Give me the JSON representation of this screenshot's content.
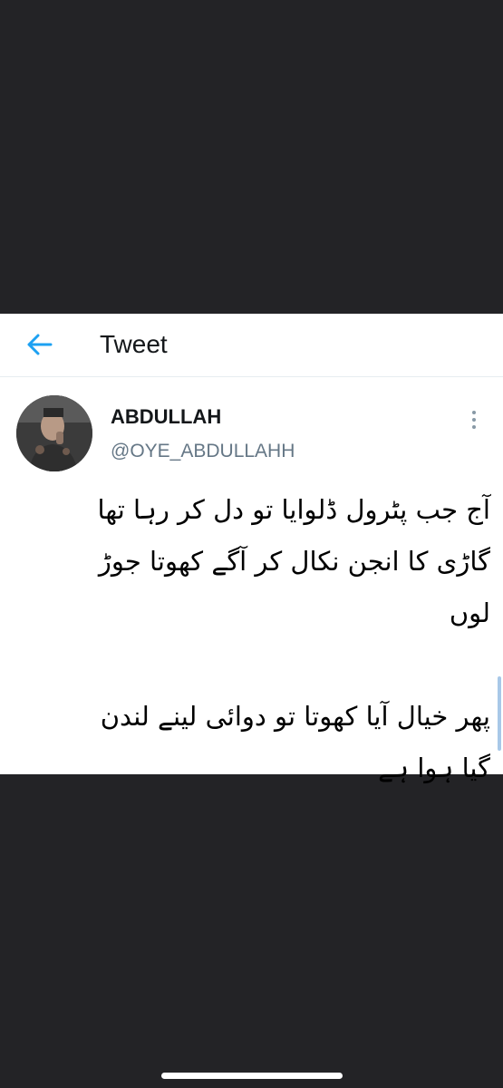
{
  "header": {
    "title": "Tweet",
    "back_icon": "arrow-left-icon",
    "accent_color": "#1da1f2"
  },
  "tweet": {
    "author": {
      "display_name": "ABDULLAH",
      "handle": "@OYE_ABDULLAHH",
      "avatar_icon": "profile-photo"
    },
    "more_icon": "vertical-ellipsis-icon",
    "text_lines_para1": [
      "آج جب پٹرول ڈلوایا تو دل کر رہا تھا",
      "گاڑی کا انجن نکال کر آگے کھوتا جوڑ",
      "لوں"
    ],
    "text_lines_para2": [
      "پھر خیال آیا کھوتا تو دوائی لینے لندن",
      "گیا ہوا ہے"
    ]
  }
}
